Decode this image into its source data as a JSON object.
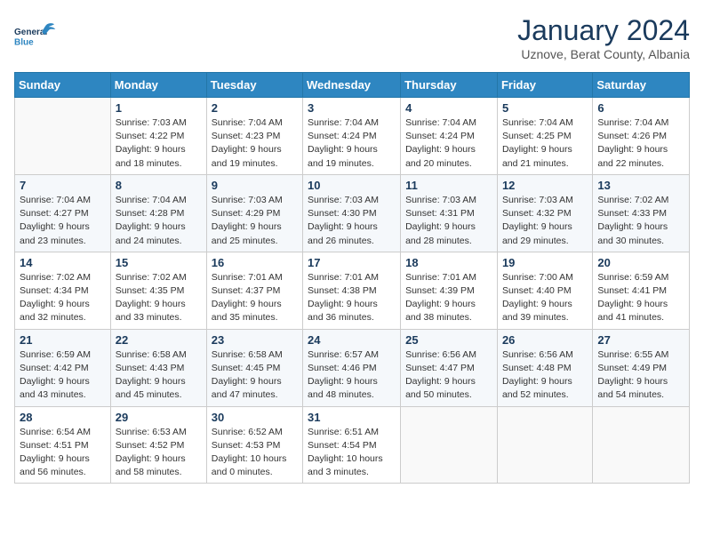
{
  "header": {
    "logo_line1": "General",
    "logo_line2": "Blue",
    "month": "January 2024",
    "location": "Uznove, Berat County, Albania"
  },
  "days_of_week": [
    "Sunday",
    "Monday",
    "Tuesday",
    "Wednesday",
    "Thursday",
    "Friday",
    "Saturday"
  ],
  "weeks": [
    [
      {
        "day": "",
        "info": ""
      },
      {
        "day": "1",
        "info": "Sunrise: 7:03 AM\nSunset: 4:22 PM\nDaylight: 9 hours\nand 18 minutes."
      },
      {
        "day": "2",
        "info": "Sunrise: 7:04 AM\nSunset: 4:23 PM\nDaylight: 9 hours\nand 19 minutes."
      },
      {
        "day": "3",
        "info": "Sunrise: 7:04 AM\nSunset: 4:24 PM\nDaylight: 9 hours\nand 19 minutes."
      },
      {
        "day": "4",
        "info": "Sunrise: 7:04 AM\nSunset: 4:24 PM\nDaylight: 9 hours\nand 20 minutes."
      },
      {
        "day": "5",
        "info": "Sunrise: 7:04 AM\nSunset: 4:25 PM\nDaylight: 9 hours\nand 21 minutes."
      },
      {
        "day": "6",
        "info": "Sunrise: 7:04 AM\nSunset: 4:26 PM\nDaylight: 9 hours\nand 22 minutes."
      }
    ],
    [
      {
        "day": "7",
        "info": "Sunrise: 7:04 AM\nSunset: 4:27 PM\nDaylight: 9 hours\nand 23 minutes."
      },
      {
        "day": "8",
        "info": "Sunrise: 7:04 AM\nSunset: 4:28 PM\nDaylight: 9 hours\nand 24 minutes."
      },
      {
        "day": "9",
        "info": "Sunrise: 7:03 AM\nSunset: 4:29 PM\nDaylight: 9 hours\nand 25 minutes."
      },
      {
        "day": "10",
        "info": "Sunrise: 7:03 AM\nSunset: 4:30 PM\nDaylight: 9 hours\nand 26 minutes."
      },
      {
        "day": "11",
        "info": "Sunrise: 7:03 AM\nSunset: 4:31 PM\nDaylight: 9 hours\nand 28 minutes."
      },
      {
        "day": "12",
        "info": "Sunrise: 7:03 AM\nSunset: 4:32 PM\nDaylight: 9 hours\nand 29 minutes."
      },
      {
        "day": "13",
        "info": "Sunrise: 7:02 AM\nSunset: 4:33 PM\nDaylight: 9 hours\nand 30 minutes."
      }
    ],
    [
      {
        "day": "14",
        "info": "Sunrise: 7:02 AM\nSunset: 4:34 PM\nDaylight: 9 hours\nand 32 minutes."
      },
      {
        "day": "15",
        "info": "Sunrise: 7:02 AM\nSunset: 4:35 PM\nDaylight: 9 hours\nand 33 minutes."
      },
      {
        "day": "16",
        "info": "Sunrise: 7:01 AM\nSunset: 4:37 PM\nDaylight: 9 hours\nand 35 minutes."
      },
      {
        "day": "17",
        "info": "Sunrise: 7:01 AM\nSunset: 4:38 PM\nDaylight: 9 hours\nand 36 minutes."
      },
      {
        "day": "18",
        "info": "Sunrise: 7:01 AM\nSunset: 4:39 PM\nDaylight: 9 hours\nand 38 minutes."
      },
      {
        "day": "19",
        "info": "Sunrise: 7:00 AM\nSunset: 4:40 PM\nDaylight: 9 hours\nand 39 minutes."
      },
      {
        "day": "20",
        "info": "Sunrise: 6:59 AM\nSunset: 4:41 PM\nDaylight: 9 hours\nand 41 minutes."
      }
    ],
    [
      {
        "day": "21",
        "info": "Sunrise: 6:59 AM\nSunset: 4:42 PM\nDaylight: 9 hours\nand 43 minutes."
      },
      {
        "day": "22",
        "info": "Sunrise: 6:58 AM\nSunset: 4:43 PM\nDaylight: 9 hours\nand 45 minutes."
      },
      {
        "day": "23",
        "info": "Sunrise: 6:58 AM\nSunset: 4:45 PM\nDaylight: 9 hours\nand 47 minutes."
      },
      {
        "day": "24",
        "info": "Sunrise: 6:57 AM\nSunset: 4:46 PM\nDaylight: 9 hours\nand 48 minutes."
      },
      {
        "day": "25",
        "info": "Sunrise: 6:56 AM\nSunset: 4:47 PM\nDaylight: 9 hours\nand 50 minutes."
      },
      {
        "day": "26",
        "info": "Sunrise: 6:56 AM\nSunset: 4:48 PM\nDaylight: 9 hours\nand 52 minutes."
      },
      {
        "day": "27",
        "info": "Sunrise: 6:55 AM\nSunset: 4:49 PM\nDaylight: 9 hours\nand 54 minutes."
      }
    ],
    [
      {
        "day": "28",
        "info": "Sunrise: 6:54 AM\nSunset: 4:51 PM\nDaylight: 9 hours\nand 56 minutes."
      },
      {
        "day": "29",
        "info": "Sunrise: 6:53 AM\nSunset: 4:52 PM\nDaylight: 9 hours\nand 58 minutes."
      },
      {
        "day": "30",
        "info": "Sunrise: 6:52 AM\nSunset: 4:53 PM\nDaylight: 10 hours\nand 0 minutes."
      },
      {
        "day": "31",
        "info": "Sunrise: 6:51 AM\nSunset: 4:54 PM\nDaylight: 10 hours\nand 3 minutes."
      },
      {
        "day": "",
        "info": ""
      },
      {
        "day": "",
        "info": ""
      },
      {
        "day": "",
        "info": ""
      }
    ]
  ]
}
